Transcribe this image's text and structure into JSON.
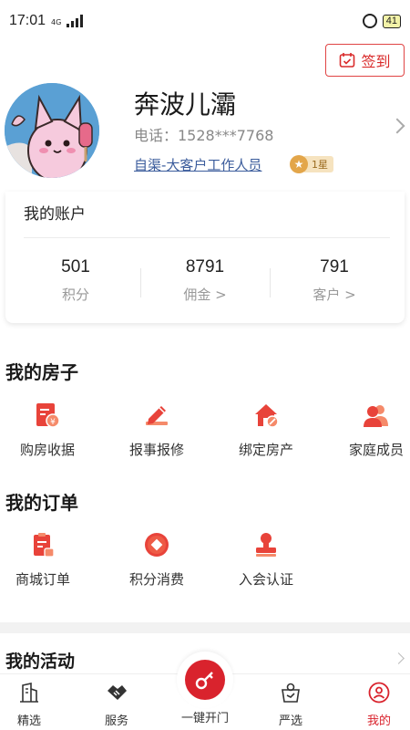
{
  "status_bar": {
    "time": "17:01",
    "network": "4G",
    "battery": "41"
  },
  "header": {
    "checkin_label": "签到",
    "username": "奔波儿灞",
    "phone": "电话：1528***7768",
    "role": "自渠-大客户工作人员",
    "level": "1星"
  },
  "account": {
    "title": "我的账户",
    "stats": [
      {
        "value": "501",
        "label": "积分"
      },
      {
        "value": "8791",
        "label": "佣金 >"
      },
      {
        "value": "791",
        "label": "客户 >"
      }
    ]
  },
  "house": {
    "title": "我的房子",
    "items": [
      {
        "label": "购房收据",
        "icon": "receipt-icon"
      },
      {
        "label": "报事报修",
        "icon": "pencil-repair-icon"
      },
      {
        "label": "绑定房产",
        "icon": "house-link-icon"
      },
      {
        "label": "家庭成员",
        "icon": "family-members-icon"
      }
    ]
  },
  "orders": {
    "title": "我的订单",
    "items": [
      {
        "label": "商城订单",
        "icon": "clipboard-order-icon"
      },
      {
        "label": "积分消费",
        "icon": "points-coin-icon"
      },
      {
        "label": "入会认证",
        "icon": "membership-stamp-icon"
      }
    ]
  },
  "activity": {
    "title": "我的活动"
  },
  "tabbar": {
    "tabs": [
      {
        "label": "精选",
        "icon": "building-icon"
      },
      {
        "label": "服务",
        "icon": "handshake-icon"
      },
      {
        "label": "一键开门",
        "icon": "key-icon"
      },
      {
        "label": "严选",
        "icon": "shopping-bag-icon"
      },
      {
        "label": "我的",
        "icon": "profile-icon",
        "active": true
      }
    ]
  },
  "colors": {
    "brand_red": "#d9232d",
    "link_blue": "#3b5c9c",
    "star_gold": "#e3a64a"
  }
}
